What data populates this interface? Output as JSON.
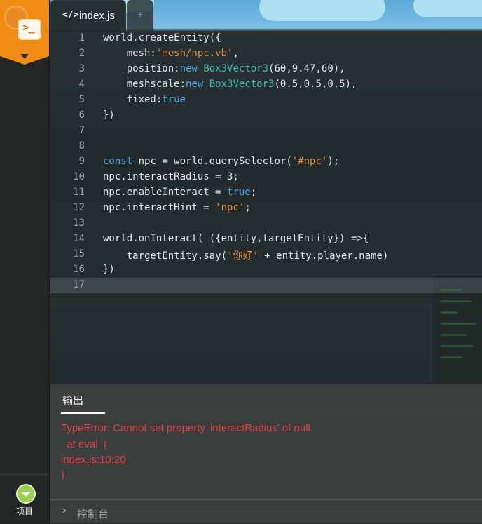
{
  "tabs": [
    {
      "label": "index.js",
      "icon": "code-icon",
      "icon_glyph": "</>"
    },
    {
      "label": "+",
      "icon": "add-tab-icon"
    }
  ],
  "sidebar": {
    "project_label": "项目",
    "logo_glyph": ">_"
  },
  "editor": {
    "current_line": 17,
    "lines": [
      {
        "n": "1",
        "tokens": [
          [
            "world.createEntity({",
            ""
          ]
        ]
      },
      {
        "n": "2",
        "tokens": [
          [
            "    mesh:",
            ""
          ],
          [
            "'mesh/npc.vb'",
            "s"
          ],
          [
            ",",
            ""
          ]
        ]
      },
      {
        "n": "3",
        "tokens": [
          [
            "    position:",
            ""
          ],
          [
            "new",
            "k"
          ],
          [
            " ",
            ""
          ],
          [
            "Box3Vector3",
            "c"
          ],
          [
            "(60,9.47,60),",
            ""
          ]
        ]
      },
      {
        "n": "4",
        "tokens": [
          [
            "    meshscale:",
            ""
          ],
          [
            "new",
            "k"
          ],
          [
            " ",
            ""
          ],
          [
            "Box3Vector3",
            "c"
          ],
          [
            "(0.5,0.5,0.5),",
            ""
          ]
        ]
      },
      {
        "n": "5",
        "tokens": [
          [
            "    fixed:",
            ""
          ],
          [
            "true",
            "k"
          ]
        ]
      },
      {
        "n": "6",
        "tokens": [
          [
            "})",
            ""
          ]
        ]
      },
      {
        "n": "7",
        "tokens": []
      },
      {
        "n": "8",
        "tokens": []
      },
      {
        "n": "9",
        "tokens": [
          [
            "const",
            "k"
          ],
          [
            " npc = world.querySelector(",
            ""
          ],
          [
            "'#npc'",
            "s"
          ],
          [
            ");",
            ""
          ]
        ]
      },
      {
        "n": "10",
        "tokens": [
          [
            "npc.interactRadius = 3;",
            ""
          ]
        ]
      },
      {
        "n": "11",
        "tokens": [
          [
            "npc.enableInteract = ",
            ""
          ],
          [
            "true",
            "k"
          ],
          [
            ";",
            ""
          ]
        ]
      },
      {
        "n": "12",
        "tokens": [
          [
            "npc.interactHint = ",
            ""
          ],
          [
            "'npc'",
            "s"
          ],
          [
            ";",
            ""
          ]
        ]
      },
      {
        "n": "13",
        "tokens": []
      },
      {
        "n": "14",
        "tokens": [
          [
            "world.onInteract( ({entity,targetEntity}) =>{",
            ""
          ]
        ]
      },
      {
        "n": "15",
        "tokens": [
          [
            "    targetEntity.say(",
            ""
          ],
          [
            "'你好'",
            "s"
          ],
          [
            " + entity.player.name)",
            ""
          ]
        ]
      },
      {
        "n": "16",
        "tokens": [
          [
            "})",
            ""
          ]
        ]
      },
      {
        "n": "17",
        "tokens": []
      }
    ]
  },
  "output": {
    "tab_label": "输出",
    "error_lines": [
      {
        "text": "TypeError: Cannot set property 'interactRadius' of null",
        "link": false
      },
      {
        "text": "  at eval  (",
        "link": false
      },
      {
        "text": "index.js:10:20",
        "link": true
      },
      {
        "text": ")",
        "link": false
      }
    ],
    "console_label": "控制台"
  },
  "colors": {
    "accent": "#f08c14",
    "keyword": "#4aa7df",
    "string": "#e0913c",
    "class": "#3fbfb0",
    "error": "#e0404a"
  }
}
